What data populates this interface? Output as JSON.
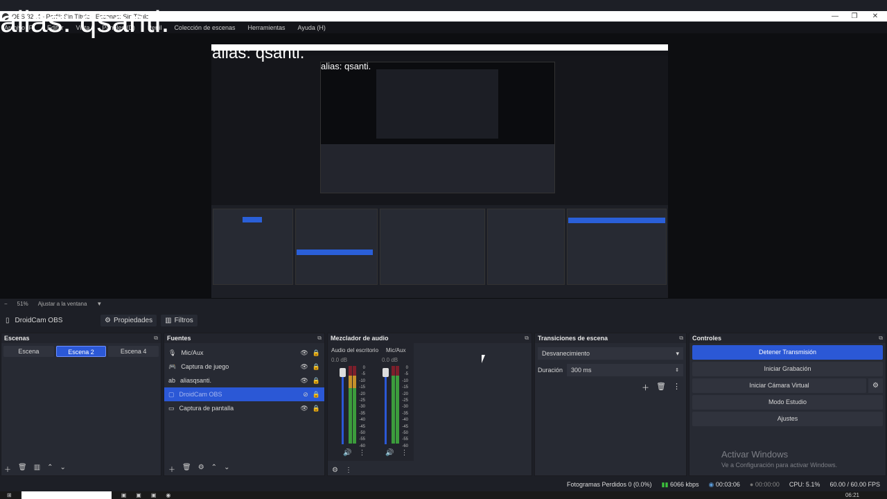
{
  "window": {
    "title": "OBS 32.‌.4 - Perfil: Sin Título - Escenas: Sin Título",
    "overlay_text": "alias: qsanti.",
    "minimize": "—",
    "maximize": "❐",
    "close": "✕"
  },
  "menu": [
    "Archivo (F)",
    "Editar",
    "Vista",
    "Paneles (D)",
    "Perfil",
    "Colección de escenas",
    "Herramientas",
    "Ayuda (H)"
  ],
  "preview": {
    "overlay_text": "alias: qsanti.",
    "inner_text": "alias: qsanti."
  },
  "zoom": {
    "level": "51%",
    "fit_label": "Ajustar a la ventana",
    "minus": "−",
    "dropdown": "▼"
  },
  "sourcebar": {
    "selected_source": "DroidCam OBS",
    "properties": "Propiedades",
    "filters": "Filtros"
  },
  "scenes": {
    "title": "Escenas",
    "items": [
      {
        "label": "Escena",
        "active": false
      },
      {
        "label": "Escena 2",
        "active": true
      },
      {
        "label": "Escena 4",
        "active": false
      }
    ]
  },
  "sources": {
    "title": "Fuentes",
    "items": [
      {
        "label": "Mic/Aux",
        "icon": "🎙",
        "active": false
      },
      {
        "label": "Captura de juego",
        "icon": "🎮",
        "active": false
      },
      {
        "label": "aliasqsanti.",
        "icon": "ab",
        "active": false
      },
      {
        "label": "DroidCam OBS",
        "icon": "▢",
        "active": true
      },
      {
        "label": "Captura de pantalla",
        "icon": "▭",
        "active": false
      }
    ]
  },
  "mixer": {
    "title": "Mezclador de audio",
    "channels": [
      {
        "name": "Audio del escritorio",
        "db": "0.0 dB",
        "level": 0.93
      },
      {
        "name": "Mic/Aux",
        "db": "0.0 dB",
        "level": 0.93
      }
    ],
    "scale": [
      "0",
      "-5",
      "-10",
      "-15",
      "-20",
      "-25",
      "-30",
      "-35",
      "-40",
      "-45",
      "-50",
      "-55",
      "-60"
    ]
  },
  "transitions": {
    "title": "Transiciones de escena",
    "selected": "Desvanecimiento",
    "duration_label": "Duración",
    "duration_value": "300 ms"
  },
  "controls": {
    "title": "Controles",
    "stop_stream": "Detener Transmisión",
    "start_recording": "Iniciar Grabación",
    "start_virtual_cam": "Iniciar Cámara Virtual",
    "studio_mode": "Modo Estudio",
    "settings": "Ajustes"
  },
  "watermark": {
    "title": "Activar Windows",
    "subtitle": "Ve a Configuración para activar Windows."
  },
  "status": {
    "dropped_frames": "Fotogramas Perdidos 0 (0.0%)",
    "bitrate": "6066 kbps",
    "stream_time": "00:03:06",
    "record_time": "00:00:00",
    "cpu": "CPU: 5.1%",
    "fps": "60.00 / 60.00 FPS"
  },
  "taskbar": {
    "time": "06:21"
  },
  "colors": {
    "accent": "#2b58d6",
    "panel": "#272a33",
    "background": "#1d1f26"
  }
}
